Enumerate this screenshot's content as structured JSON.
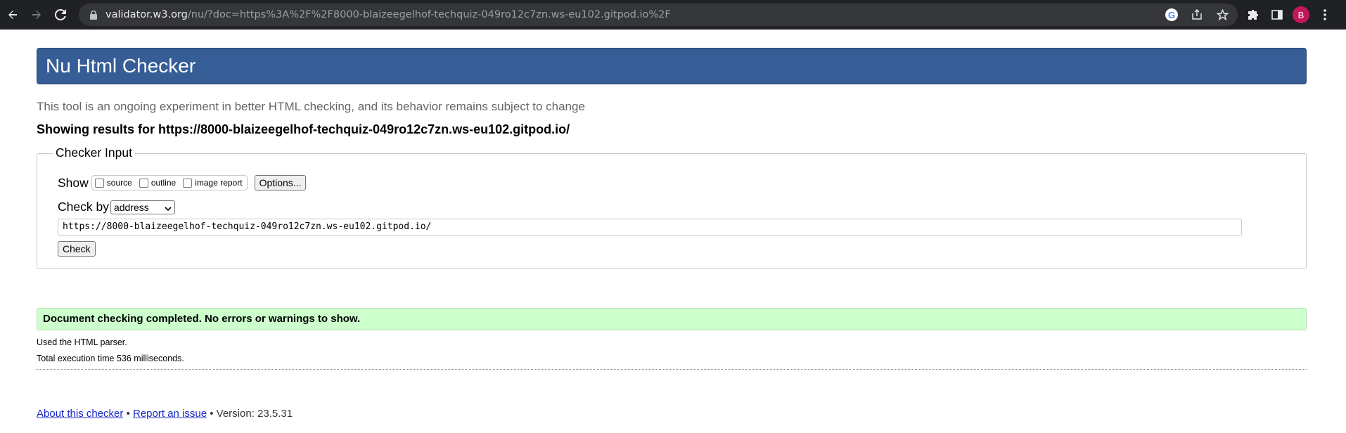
{
  "browser": {
    "url_host": "validator.w3.org",
    "url_rest": "/nu/?doc=https%3A%2F%2F8000-blaizeegelhof-techquiz-049ro12c7zn.ws-eu102.gitpod.io%2F",
    "avatar_letter": "B",
    "google_letter": "G",
    "icons": [
      "back-icon",
      "forward-icon",
      "reload-icon",
      "lock-icon",
      "google-icon",
      "share-icon",
      "star-icon",
      "extensions-icon",
      "side-panel-icon",
      "avatar",
      "menu-icon"
    ]
  },
  "header": {
    "title": "Nu Html Checker"
  },
  "tagline": "This tool is an ongoing experiment in better HTML checking, and its behavior remains subject to change",
  "showing": {
    "prefix": "Showing results for ",
    "url": "https://8000-blaizeegelhof-techquiz-049ro12c7zn.ws-eu102.gitpod.io/"
  },
  "checker_input": {
    "legend": "Checker Input",
    "show_label": "Show",
    "options": [
      {
        "label": "source",
        "checked": false
      },
      {
        "label": "outline",
        "checked": false
      },
      {
        "label": "image report",
        "checked": false
      }
    ],
    "options_button": "Options...",
    "check_by_label": "Check by",
    "check_by_value": "address",
    "url_value": "https://8000-blaizeegelhof-techquiz-049ro12c7zn.ws-eu102.gitpod.io/",
    "check_button": "Check"
  },
  "results": {
    "success": "Document checking completed. No errors or warnings to show.",
    "parser": "Used the HTML parser.",
    "execution": "Total execution time 536 milliseconds."
  },
  "footer": {
    "about": "About this checker",
    "sep": " • ",
    "report": "Report an issue",
    "version": "Version: 23.5.31"
  },
  "colors": {
    "header_bg": "#365d95",
    "success_bg": "#ccffcc",
    "chrome_bg": "#202124",
    "avatar_bg": "#c2185b"
  }
}
